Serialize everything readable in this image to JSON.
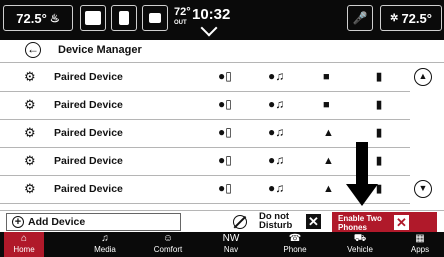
{
  "status_bar": {
    "temp_left": "72.5°",
    "outside_temp": "72°",
    "outside_label": "OUT",
    "time": "10:32",
    "temp_right": "72.5°",
    "icons": [
      "seat-heat-icon",
      "person-icon",
      "phone-icon",
      "camera-icon",
      "mic-icon",
      "fan-icon"
    ]
  },
  "header": {
    "title": "Device Manager",
    "back_icon": "back-arrow-icon"
  },
  "devices": [
    {
      "label": "Paired Device"
    },
    {
      "label": "Paired Device"
    },
    {
      "label": "Paired Device"
    },
    {
      "label": "Paired Device"
    },
    {
      "label": "Paired Device"
    }
  ],
  "actions": {
    "add_device": "Add Device",
    "dnd_line1": "Do not",
    "dnd_line2": "Disturb",
    "enable_two_phones": "Enable Two Phones"
  },
  "nav": {
    "items": [
      {
        "label": "Home",
        "icon": "home-icon",
        "glyph": "⌂",
        "active": true
      },
      {
        "label": "Media",
        "icon": "music-icon",
        "glyph": "♫",
        "active": false
      },
      {
        "label": "Comfort",
        "icon": "seat-icon",
        "glyph": "☺",
        "active": false
      },
      {
        "label": "Nav",
        "icon": "compass-icon",
        "glyph": "NW",
        "active": false
      },
      {
        "label": "Phone",
        "icon": "phone-icon",
        "glyph": "☎",
        "active": false
      },
      {
        "label": "Vehicle",
        "icon": "car-icon",
        "glyph": "🚗",
        "active": false
      },
      {
        "label": "Apps",
        "icon": "grid-icon",
        "glyph": "▦",
        "active": false
      }
    ]
  },
  "colors": {
    "accent": "#b0192a",
    "bar": "#0a0a0a"
  }
}
